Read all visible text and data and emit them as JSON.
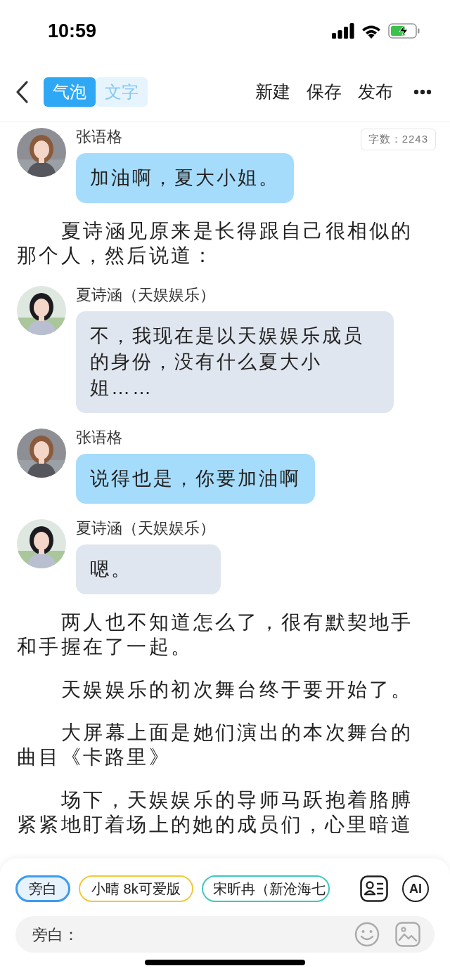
{
  "status_bar": {
    "time": "10:59"
  },
  "nav": {
    "tabs": [
      {
        "label": "气泡",
        "selected": true
      },
      {
        "label": "文字",
        "selected": false
      }
    ],
    "actions": [
      "新建",
      "保存",
      "发布"
    ]
  },
  "word_count": "字数：2243",
  "messages": [
    {
      "kind": "bubble",
      "speaker": "张语格",
      "text": "加油啊，夏大小姐。",
      "color": "#a6dcfb"
    },
    {
      "kind": "narration",
      "text": "夏诗涵见原来是长得跟自己很相似的那个人，然后说道："
    },
    {
      "kind": "bubble",
      "speaker": "夏诗涵（天娱娱乐）",
      "text": "不，我现在是以天娱娱乐成员的身份，没有什么夏大小姐……",
      "color": "#e0e6ef"
    },
    {
      "kind": "bubble",
      "speaker": "张语格",
      "text": "说得也是，你要加油啊",
      "color": "#a6dcfb"
    },
    {
      "kind": "bubble",
      "speaker": "夏诗涵（天娱娱乐）",
      "text": "嗯。",
      "color": "#e0e6ef"
    },
    {
      "kind": "narration",
      "text": "两人也不知道怎么了，很有默契地手和手握在了一起。"
    },
    {
      "kind": "narration",
      "text": "天娱娱乐的初次舞台终于要开始了。"
    },
    {
      "kind": "narration",
      "text": "大屏幕上面是她们演出的本次舞台的曲目《卡路里》"
    },
    {
      "kind": "narration",
      "text": "场下，天娱娱乐的导师马跃抱着胳膊紧紧地盯着场上的她的成员们，心里暗道"
    }
  ],
  "composer": {
    "chips": [
      {
        "label": "旁白",
        "color": "#3d9bf0",
        "selected": true
      },
      {
        "label": "小晴 8k可爱版",
        "color": "#f0c93a",
        "selected": false
      },
      {
        "label": "宋昕冉（新沧海七",
        "color": "#3cc8c0",
        "selected": false
      }
    ],
    "ai_label": "AI",
    "input_placeholder": "旁白："
  }
}
